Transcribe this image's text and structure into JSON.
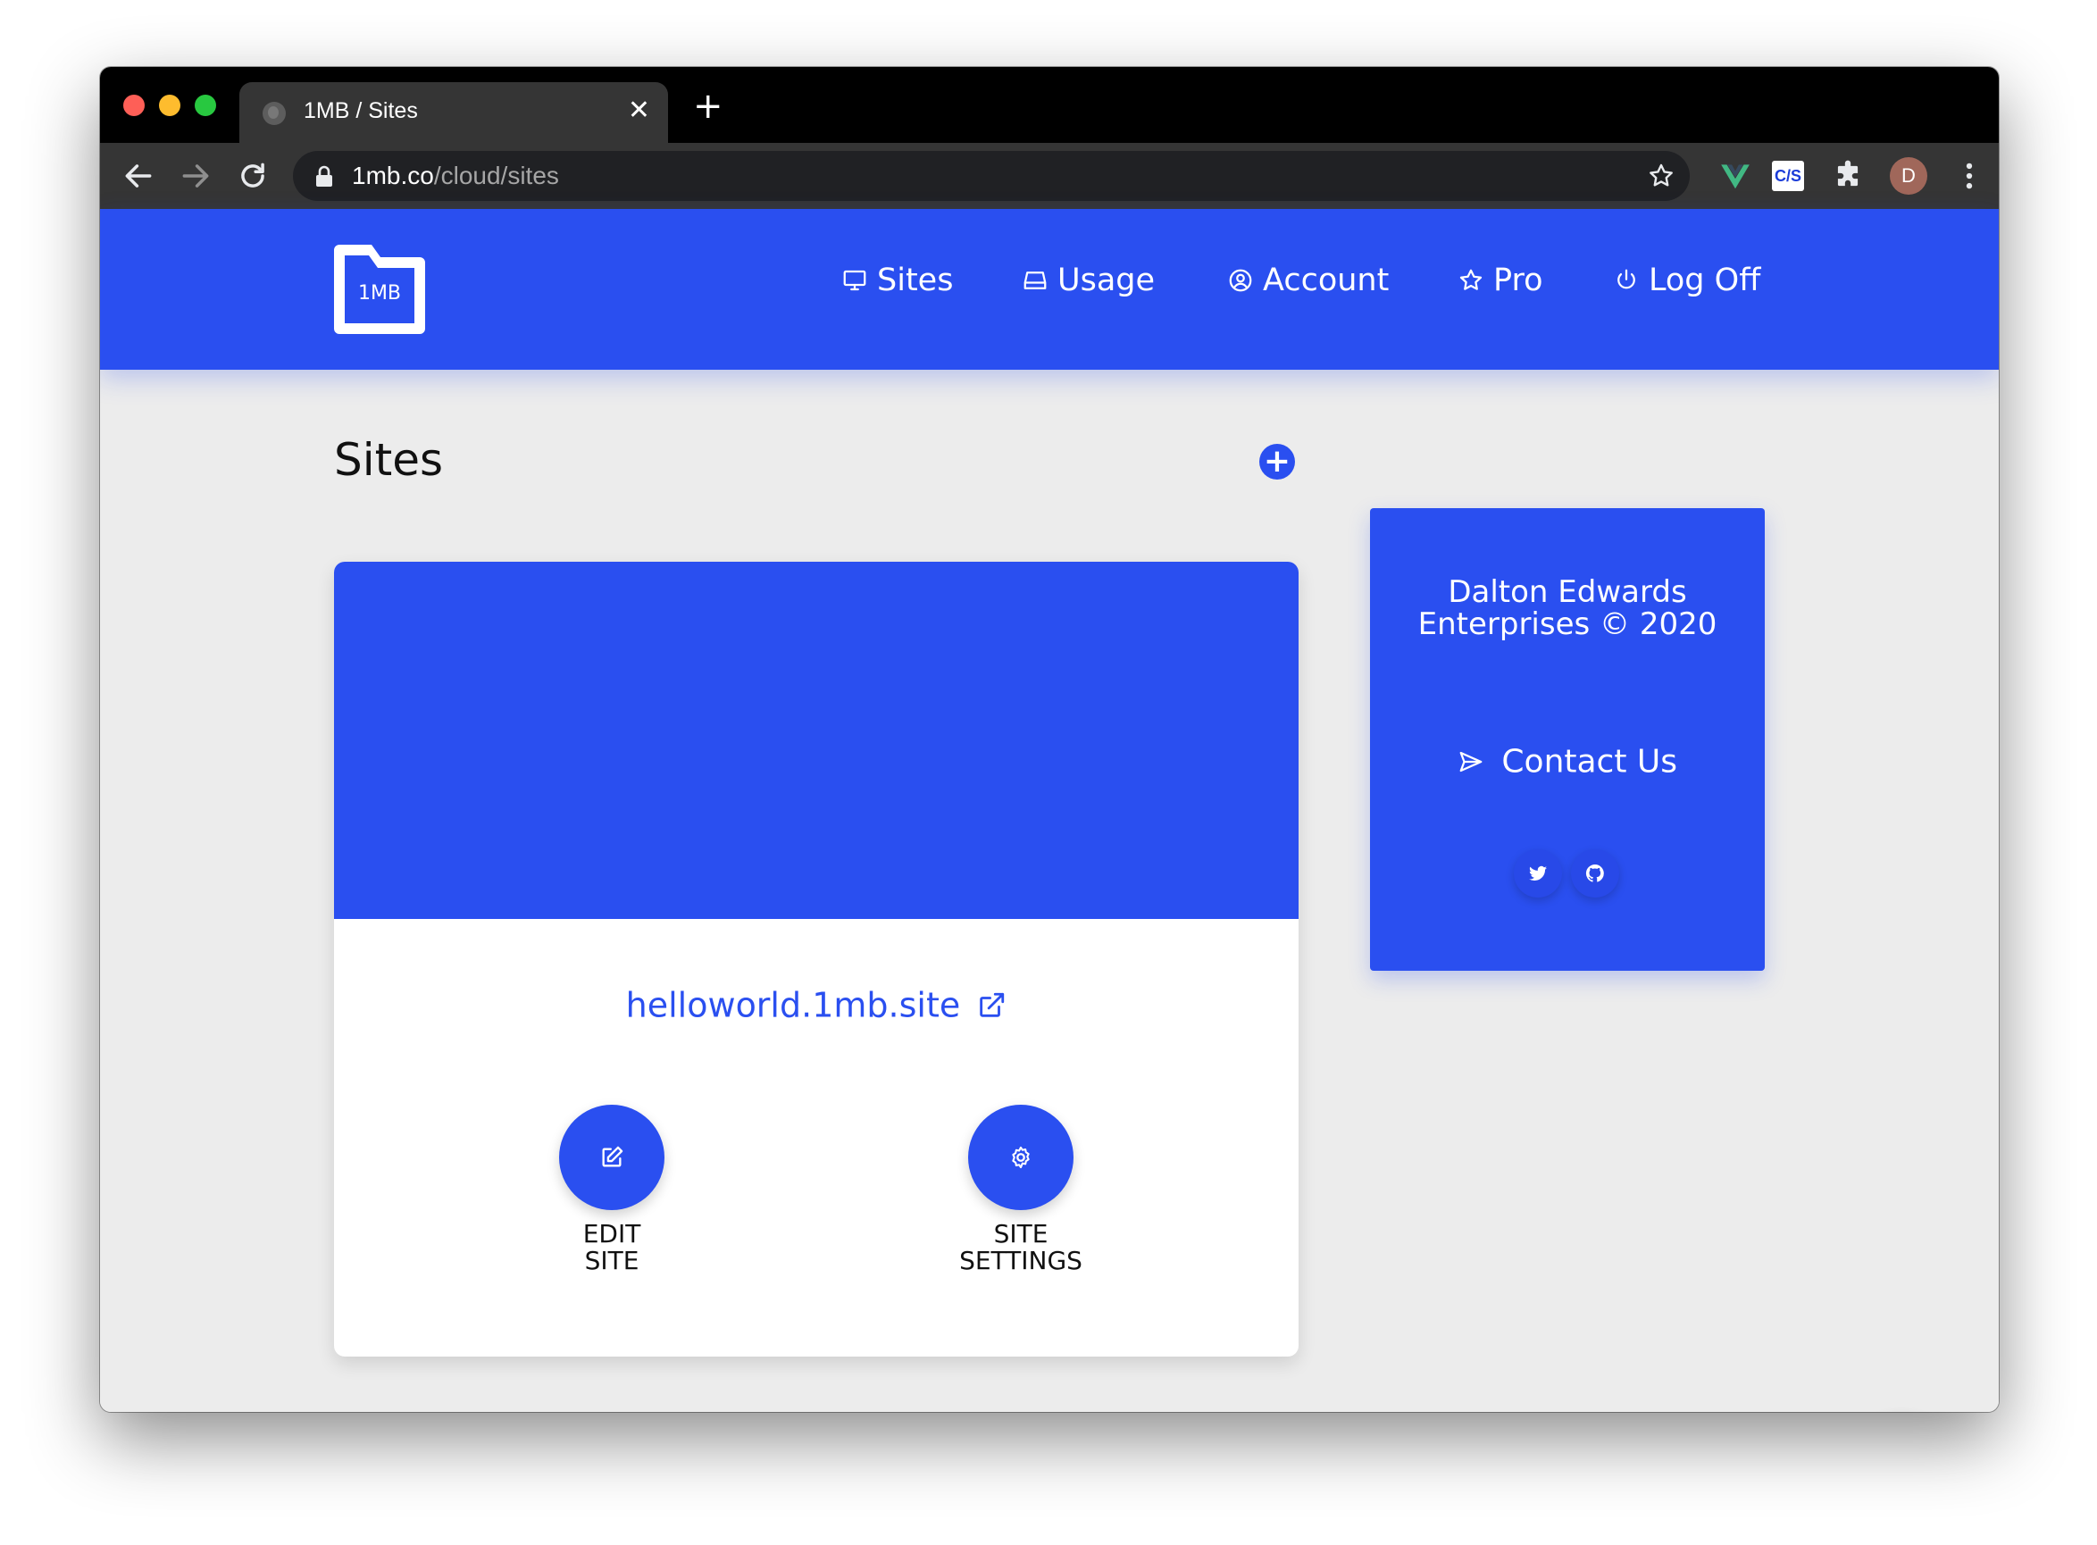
{
  "browser": {
    "tab_title": "1MB / Sites",
    "tab_close": "✕",
    "new_tab": "+",
    "url_host": "1mb.co",
    "url_path": "/cloud/sites",
    "profile_initial": "D",
    "extension_cjs_label": "C/S"
  },
  "app": {
    "logo_text": "1MB",
    "nav": {
      "sites": "Sites",
      "usage": "Usage",
      "account": "Account",
      "pro": "Pro",
      "log_off": "Log Off"
    },
    "page_title": "Sites",
    "add_button": "+",
    "site": {
      "domain": "helloworld.1mb.site",
      "edit_label": "EDIT\nSITE",
      "settings_label": "SITE\nSETTINGS"
    },
    "sidebar": {
      "company": "Dalton Edwards Enterprises © 2020",
      "contact": "Contact Us"
    }
  },
  "colors": {
    "brand": "#2a4ff0",
    "chat": "#1a73f0",
    "page_bg": "#ececec"
  }
}
